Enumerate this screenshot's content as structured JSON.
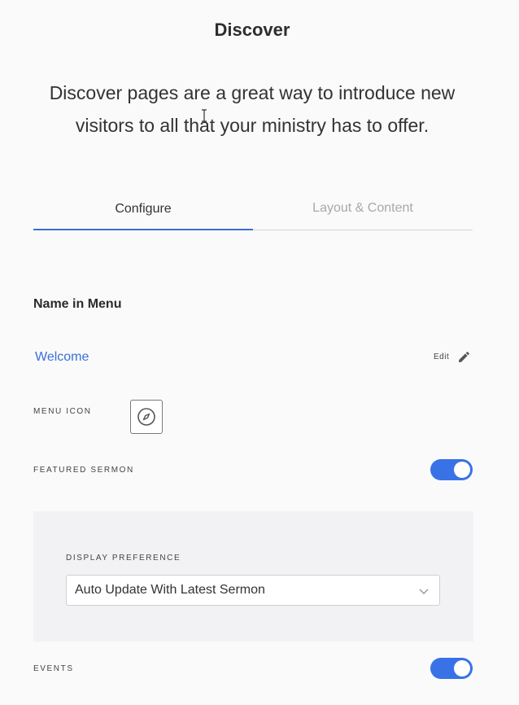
{
  "page": {
    "title": "Discover",
    "intro": "Discover pages are a great way to introduce new visitors to all that your ministry has to offer."
  },
  "tabs": [
    {
      "label": "Configure",
      "active": true
    },
    {
      "label": "Layout & Content",
      "active": false
    }
  ],
  "name_in_menu": {
    "heading": "Name in Menu",
    "value": "Welcome",
    "edit_label": "Edit",
    "edit_icon": "pencil-icon"
  },
  "menu_icon": {
    "label": "MENU ICON",
    "icon": "compass-icon"
  },
  "featured_sermon": {
    "label": "FEATURED SERMON",
    "enabled": true
  },
  "display_preference": {
    "label": "DISPLAY PREFERENCE",
    "selected": "Auto Update With Latest Sermon"
  },
  "events": {
    "label": "EVENTS",
    "enabled": true
  },
  "colors": {
    "accent": "#3872e6",
    "link": "#3b6fd8",
    "panel": "#f2f2f4"
  }
}
